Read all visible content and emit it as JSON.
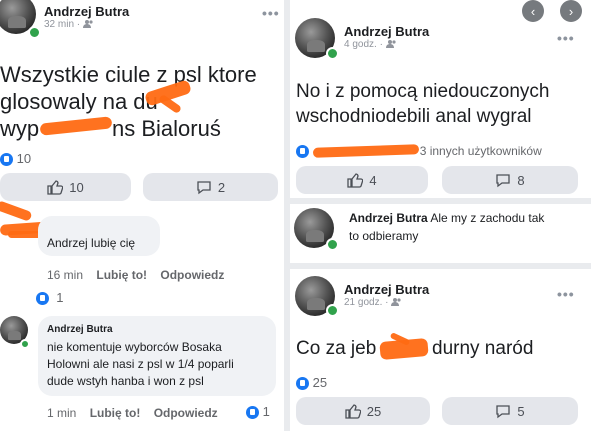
{
  "colors": {
    "like_blue": "#1877f2",
    "online_green": "#31a24c",
    "scribble_orange": "#ff6a13",
    "bubble_bg": "#f0f2f5",
    "button_bg": "#e4e6eb"
  },
  "left": {
    "post": {
      "author": "Andrzej Butra",
      "time": "32 min ·",
      "privacy_icon": "friends-icon",
      "menu": "•••",
      "text_line1": "Wszystkie ciule z psl ktore",
      "text_line2a": "glosowaly na du",
      "text_line3a": "wyp",
      "text_line3b": "ns Bialoruś",
      "reactions_count": "10",
      "like_button_count": "10",
      "comment_button_count": "2"
    },
    "comment1": {
      "text": "Andrzej lubię cię",
      "time": "16 min",
      "like_label": "Lubię to!",
      "reply_label": "Odpowiedz",
      "reactions_count": "1"
    },
    "comment2": {
      "author": "Andrzej Butra",
      "line1": "nie komentuje wyborców  Bosaka",
      "line2": "Holowni ale nasi z psl w 1/4 poparli",
      "line3": "dude wstyh hanba i won z psl",
      "time": "1 min",
      "like_label": "Lubię to!",
      "reply_label": "Odpowiedz",
      "reactions_count": "1"
    }
  },
  "right": {
    "nav": {
      "prev": "‹",
      "next": "›"
    },
    "post1": {
      "author": "Andrzej Butra",
      "time": "4 godz. ·",
      "menu": "•••",
      "line1": "No i z pomocą niedouczonych",
      "line2": "wschodniodebili anal wygral",
      "reactions_suffix": "3 innych użytkowników",
      "like_button_count": "4",
      "comment_button_count": "8"
    },
    "comment": {
      "author": "Andrzej Butra",
      "text_after_name": "Ale my z zachodu tak",
      "line2": "to odbieramy"
    },
    "post2": {
      "author": "Andrzej Butra",
      "time": "21 godz. ·",
      "menu": "•••",
      "text_a": "Co za jeb",
      "text_b": "durny naród",
      "reactions_count": "25",
      "like_button_count": "25",
      "comment_button_count": "5"
    }
  }
}
